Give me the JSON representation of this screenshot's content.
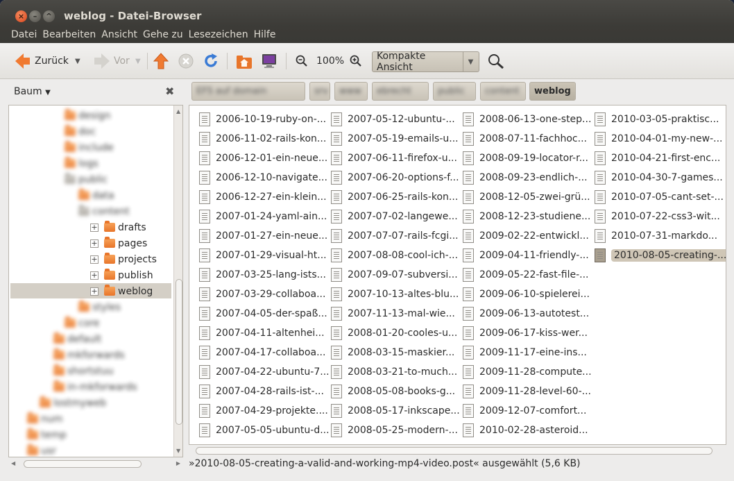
{
  "window": {
    "title": "weblog - Datei-Browser",
    "close_glyph": "×",
    "min_glyph": "–",
    "max_glyph": "^"
  },
  "menu": [
    "Datei",
    "Bearbeiten",
    "Ansicht",
    "Gehe zu",
    "Lesezeichen",
    "Hilfe"
  ],
  "toolbar": {
    "back_label": "Zurück",
    "forward_label": "Vor",
    "zoom_level": "100%",
    "view_mode": "Kompakte Ansicht",
    "icons": [
      "back-arrow-icon",
      "forward-arrow-icon",
      "up-arrow-icon",
      "stop-icon",
      "reload-icon",
      "home-folder-icon",
      "computer-icon",
      "zoom-out-icon",
      "zoom-in-icon",
      "search-icon"
    ]
  },
  "sidebar": {
    "header": "Baum",
    "tree": [
      {
        "label": "drafts"
      },
      {
        "label": "pages"
      },
      {
        "label": "projects"
      },
      {
        "label": "publish"
      },
      {
        "label": "weblog",
        "selected": true
      }
    ],
    "blurred_above": [
      "design",
      "doc",
      "include",
      "logs",
      "public",
      "data",
      "content"
    ],
    "blurred_below": [
      "styles",
      "core",
      "default",
      "mkforwards",
      "shortstuu",
      "in-mkforwards",
      "lostmyweb",
      "num",
      "temp",
      "usr"
    ]
  },
  "breadcrumbs": {
    "blurred": [
      "EFS auf domain",
      "srv",
      "www",
      "ebrecht",
      "public",
      "content"
    ],
    "current": "weblog"
  },
  "files": {
    "columns": [
      [
        "2006-10-19-ruby-on-...",
        "2006-11-02-rails-kon...",
        "2006-12-01-ein-neue...",
        "2006-12-10-navigate...",
        "2006-12-27-ein-klein...",
        "2007-01-24-yaml-ain...",
        "2007-01-27-ein-neue...",
        "2007-01-29-visual-ht...",
        "2007-03-25-lang-ists...",
        "2007-03-29-collaboa...",
        "2007-04-05-der-spaß...",
        "2007-04-11-altenhei...",
        "2007-04-17-collaboa...",
        "2007-04-22-ubuntu-7...",
        "2007-04-28-rails-ist-...",
        "2007-04-29-projekte....",
        "2007-05-05-ubuntu-d..."
      ],
      [
        "2007-05-12-ubuntu-...",
        "2007-05-19-emails-u...",
        "2007-06-11-firefox-u...",
        "2007-06-20-options-f...",
        "2007-06-25-rails-kon...",
        "2007-07-02-langewe...",
        "2007-07-07-rails-fcgi...",
        "2007-08-08-cool-ich-...",
        "2007-09-07-subversi...",
        "2007-10-13-altes-blu...",
        "2007-11-13-mal-wie...",
        "2008-01-20-cooles-u...",
        "2008-03-15-maskier...",
        "2008-03-21-to-much...",
        "2008-05-08-books-g...",
        "2008-05-17-inkscape...",
        "2008-05-25-modern-..."
      ],
      [
        "2008-06-13-one-step...",
        "2008-07-11-fachhoc...",
        "2008-09-19-locator-r...",
        "2008-09-23-endlich-...",
        "2008-12-05-zwei-grü...",
        "2008-12-23-studiene...",
        "2009-02-22-entwickl...",
        "2009-04-11-friendly-...",
        "2009-05-22-fast-file-...",
        "2009-06-10-spielerei...",
        "2009-06-13-autotest...",
        "2009-06-17-kiss-wer...",
        "2009-11-17-eine-ins...",
        "2009-11-28-compute...",
        "2009-11-28-level-60-...",
        "2009-12-07-comfort...",
        "2010-02-28-asteroid..."
      ],
      [
        "2010-03-05-praktisc...",
        "2010-04-01-my-new-...",
        "2010-04-21-first-enc...",
        "2010-04-30-7-games...",
        "2010-07-05-cant-set-...",
        "2010-07-22-css3-wit...",
        "2010-07-31-markdo...",
        "2010-08-05-creating-..."
      ]
    ],
    "selected": "2010-08-05-creating-..."
  },
  "status": "»2010-08-05-creating-a-valid-and-working-mp4-video.post« ausgewählt (5,6 KB)",
  "colors": {
    "accent_orange": "#f07a31",
    "selection": "#cfc6b6",
    "titlebar": "#3c3b37"
  }
}
